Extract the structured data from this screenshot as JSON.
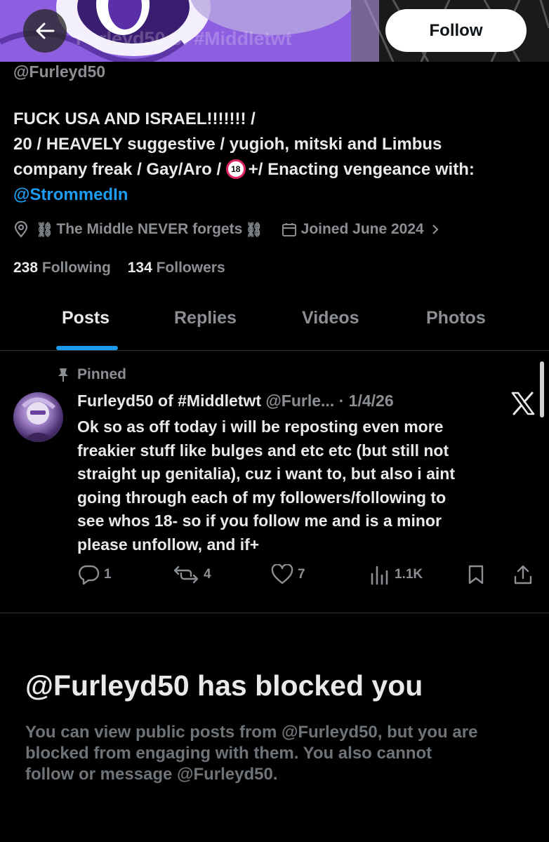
{
  "header": {
    "faded_name": "Furleyd50 of #Middletwt",
    "follow_label": "Follow"
  },
  "profile": {
    "handle": "@Furleyd50",
    "bio": {
      "line1": "FUCK USA AND ISRAEL!!!!!!! /",
      "line2": "20 / HEAVELY suggestive / yugioh, mitski and Limbus",
      "line3a": "company freak / Gay/Aro / ",
      "badge": "18",
      "line3b": "+/ Enacting vengeance with:",
      "mention": "@StrommedIn"
    },
    "location": "The Middle NEVER forgets",
    "joined": "Joined June 2024",
    "following_count": "238",
    "following_label": "Following",
    "followers_count": "134",
    "followers_label": "Followers"
  },
  "tabs": [
    {
      "label": "Posts",
      "active": true
    },
    {
      "label": "Replies"
    },
    {
      "label": "Videos"
    },
    {
      "label": "Photos"
    }
  ],
  "post": {
    "pinned_label": "Pinned",
    "author": "Furleyd50 of #Middletwt",
    "handle": "@Furle...",
    "separator": "·",
    "date": "1/4/26",
    "lines": [
      "Ok so as off today i will be reposting even more",
      "freakier stuff like bulges and etc etc (but still not",
      "straight up genitalia), cuz i want to, but also i aint",
      "going through each of my followers/following to",
      "see whos 18- so if you follow me and is a minor",
      "please unfollow, and if+"
    ],
    "replies": "1",
    "reposts": "4",
    "likes": "7",
    "views": "1.1K"
  },
  "blocked": {
    "title": "@Furleyd50 has blocked you",
    "lines": [
      "You can view public posts from @Furleyd50, but you are",
      "blocked from engaging with them. You also cannot",
      "follow or message @Furleyd50."
    ]
  },
  "colors": {
    "background": "#000000",
    "text": "#e7e9ea",
    "secondary": "#8b8f94",
    "accent": "#1d9bf0"
  },
  "icons": [
    "back-arrow-icon",
    "location-icon",
    "chain-icon",
    "calendar-icon",
    "chevron-right-icon",
    "pin-icon",
    "x-logo-icon",
    "reply-icon",
    "repost-icon",
    "like-icon",
    "views-icon",
    "bookmark-icon",
    "share-icon"
  ]
}
